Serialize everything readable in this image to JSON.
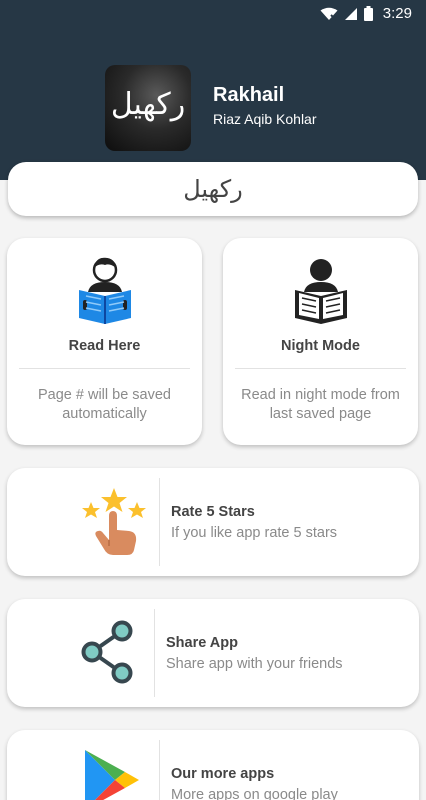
{
  "status_bar": {
    "time": "3:29",
    "icons": [
      "wifi-off-icon",
      "signal-icon",
      "battery-icon"
    ]
  },
  "app": {
    "title": "Rakhail",
    "author": "Riaz Aqib Kohlar",
    "logo_text": "رکھیل"
  },
  "book_title": "رکھیل",
  "cards": {
    "read": {
      "title": "Read Here",
      "description": "Page # will be saved automatically",
      "icon": "person-reading-icon"
    },
    "night": {
      "title": "Night Mode",
      "description": "Read in night mode from last saved page",
      "icon": "person-reading-dark-icon"
    }
  },
  "actions": {
    "rate": {
      "title": "Rate 5 Stars",
      "subtitle": "If you like app rate 5 stars",
      "icon": "rate-stars-icon"
    },
    "share": {
      "title": "Share App",
      "subtitle": "Share app with your friends",
      "icon": "share-icon"
    },
    "more": {
      "title": "Our more apps",
      "subtitle": "More apps on google play",
      "icon": "google-play-icon"
    }
  },
  "colors": {
    "header": "#263745",
    "card": "#ffffff",
    "text": "#444444",
    "muted": "#8a8a8a",
    "share_icon": "#37474f",
    "book_blue": "#1e88e5"
  }
}
